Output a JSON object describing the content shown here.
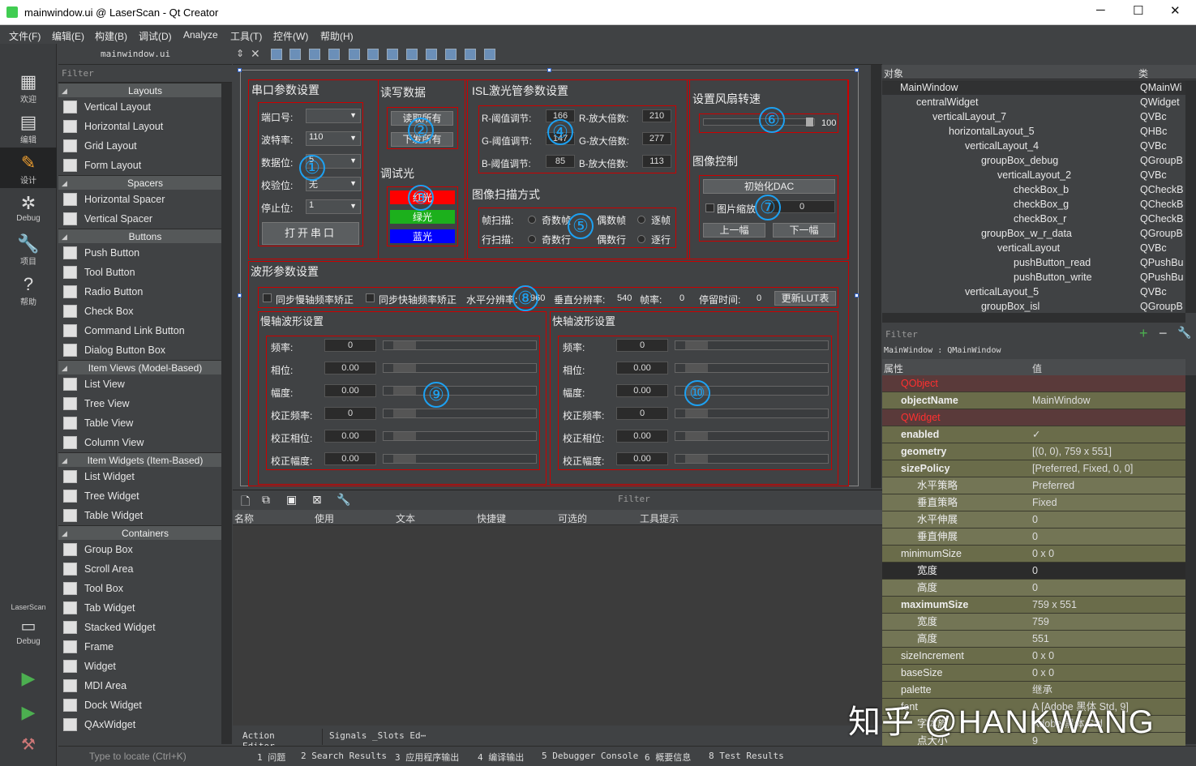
{
  "window": {
    "title": "mainwindow.ui @ LaserScan - Qt Creator",
    "min": "─",
    "max": "☐",
    "close": "✕"
  },
  "menu": [
    "文件(F)",
    "编辑(E)",
    "构建(B)",
    "调试(D)",
    "Analyze",
    "工具(T)",
    "控件(W)",
    "帮助(H)"
  ],
  "modes": [
    {
      "label": "欢迎",
      "icon": "▦"
    },
    {
      "label": "编辑",
      "icon": "▤"
    },
    {
      "label": "设计",
      "icon": "✎"
    },
    {
      "label": "Debug",
      "icon": "✲"
    },
    {
      "label": "项目",
      "icon": "🔧"
    },
    {
      "label": "帮助",
      "icon": "?"
    }
  ],
  "kit": {
    "name": "LaserScan",
    "debug": "Debug"
  },
  "editor": {
    "file": "mainwindow.ui"
  },
  "widgetbox": {
    "filter": "Filter",
    "categories": [
      {
        "name": "Layouts",
        "items": [
          "Vertical Layout",
          "Horizontal Layout",
          "Grid Layout",
          "Form Layout"
        ]
      },
      {
        "name": "Spacers",
        "items": [
          "Horizontal Spacer",
          "Vertical Spacer"
        ]
      },
      {
        "name": "Buttons",
        "items": [
          "Push Button",
          "Tool Button",
          "Radio Button",
          "Check Box",
          "Command Link Button",
          "Dialog Button Box"
        ]
      },
      {
        "name": "Item Views (Model-Based)",
        "items": [
          "List View",
          "Tree View",
          "Table View",
          "Column View"
        ]
      },
      {
        "name": "Item Widgets (Item-Based)",
        "items": [
          "List Widget",
          "Tree Widget",
          "Table Widget"
        ]
      },
      {
        "name": "Containers",
        "items": [
          "Group Box",
          "Scroll Area",
          "Tool Box",
          "Tab Widget",
          "Stacked Widget",
          "Frame",
          "Widget",
          "MDI Area",
          "Dock Widget",
          "QAxWidget"
        ]
      }
    ]
  },
  "form": {
    "serial": {
      "title": "串口参数设置",
      "port": "端口号:",
      "baud": "波特率:",
      "baud_val": "110",
      "data": "数据位:",
      "data_val": "5",
      "parity": "校验位:",
      "parity_val": "无",
      "stop": "停止位:",
      "stop_val": "1",
      "open": "打开串口"
    },
    "rw": {
      "title": "读写数据",
      "read": "读取所有",
      "write": "下发所有"
    },
    "light": {
      "title": "调试光",
      "red": "红光",
      "green": "绿光",
      "blue": "蓝光"
    },
    "isl": {
      "title": "ISL激光管参数设置",
      "r_th": "R-阈值调节:",
      "r_th_v": "166",
      "r_amp": "R-放大倍数:",
      "r_amp_v": "210",
      "g_th": "G-阈值调节:",
      "g_th_v": "147",
      "g_amp": "G-放大倍数:",
      "g_amp_v": "277",
      "b_th": "B-阈值调节:",
      "b_th_v": "85",
      "b_amp": "B-放大倍数:",
      "b_amp_v": "113"
    },
    "scan": {
      "title": "图像扫描方式",
      "frame": "帧扫描:",
      "odd_f": "奇数帧",
      "even_f": "偶数帧",
      "per_f": "逐帧",
      "line": "行扫描:",
      "odd_l": "奇数行",
      "even_l": "偶数行",
      "per_l": "逐行"
    },
    "fan": {
      "title": "设置风扇转速",
      "val": "100"
    },
    "img": {
      "title": "图像控制",
      "init": "初始化DAC",
      "zoom": "图片缩放",
      "zoom_v": "0",
      "prev": "上一幅",
      "next": "下一幅"
    },
    "wave": {
      "title": "波形参数设置",
      "sync_slow": "同步慢轴频率矫正",
      "sync_fast": "同步快轴频率矫正",
      "hres": "水平分辨率:",
      "hres_v": "960",
      "vres": "垂直分辨率:",
      "vres_v": "540",
      "fps": "帧率:",
      "fps_v": "0",
      "stay": "停留时间:",
      "stay_v": "0",
      "update": "更新LUT表"
    },
    "slow": {
      "title": "慢轴波形设置",
      "rows": [
        {
          "k": "频率:",
          "v": "0"
        },
        {
          "k": "相位:",
          "v": "0.00"
        },
        {
          "k": "幅度:",
          "v": "0.00"
        },
        {
          "k": "校正频率:",
          "v": "0"
        },
        {
          "k": "校正相位:",
          "v": "0.00"
        },
        {
          "k": "校正幅度:",
          "v": "0.00"
        }
      ]
    },
    "fast": {
      "title": "快轴波形设置",
      "rows": [
        {
          "k": "频率:",
          "v": "0"
        },
        {
          "k": "相位:",
          "v": "0.00"
        },
        {
          "k": "幅度:",
          "v": "0.00"
        },
        {
          "k": "校正频率:",
          "v": "0"
        },
        {
          "k": "校正相位:",
          "v": "0.00"
        },
        {
          "k": "校正幅度:",
          "v": "0.00"
        }
      ]
    },
    "marks": [
      "①",
      "②",
      "③",
      "④",
      "⑤",
      "⑥",
      "⑦",
      "⑧",
      "⑨",
      "⑩"
    ]
  },
  "action": {
    "filter": "Filter",
    "cols": [
      "名称",
      "使用",
      "文本",
      "快捷键",
      "可选的",
      "工具提示"
    ],
    "tabs": [
      "Action Editor",
      "Signals _Slots Ed⋯"
    ]
  },
  "objects": {
    "col1": "对象",
    "col2": "类",
    "rows": [
      {
        "n": "MainWindow",
        "c": "QMainWi",
        "d": 0
      },
      {
        "n": "centralWidget",
        "c": "QWidget",
        "d": 1
      },
      {
        "n": "verticalLayout_7",
        "c": "QVBc",
        "d": 2
      },
      {
        "n": "horizontalLayout_5",
        "c": "QHBc",
        "d": 3
      },
      {
        "n": "verticalLayout_4",
        "c": "QVBc",
        "d": 4
      },
      {
        "n": "groupBox_debug",
        "c": "QGroupB",
        "d": 5
      },
      {
        "n": "verticalLayout_2",
        "c": "QVBc",
        "d": 6
      },
      {
        "n": "checkBox_b",
        "c": "QCheckB",
        "d": 7
      },
      {
        "n": "checkBox_g",
        "c": "QCheckB",
        "d": 7
      },
      {
        "n": "checkBox_r",
        "c": "QCheckB",
        "d": 7
      },
      {
        "n": "groupBox_w_r_data",
        "c": "QGroupB",
        "d": 5
      },
      {
        "n": "verticalLayout",
        "c": "QVBc",
        "d": 6
      },
      {
        "n": "pushButton_read",
        "c": "QPushBu",
        "d": 7
      },
      {
        "n": "pushButton_write",
        "c": "QPushBu",
        "d": 7
      },
      {
        "n": "verticalLayout_5",
        "c": "QVBc",
        "d": 4
      },
      {
        "n": "groupBox_isl",
        "c": "QGroupB",
        "d": 5
      }
    ]
  },
  "props": {
    "filter": "Filter",
    "context": "MainWindow : QMainWindow",
    "col1": "属性",
    "col2": "值",
    "rows": [
      {
        "k": "QObject",
        "v": "",
        "t": "sec"
      },
      {
        "k": "objectName",
        "v": "MainWindow",
        "t": "bold"
      },
      {
        "k": "QWidget",
        "v": "",
        "t": "sec"
      },
      {
        "k": "enabled",
        "v": "✓",
        "t": "bold"
      },
      {
        "k": "geometry",
        "v": "[(0, 0), 759 x 551]",
        "t": "bold"
      },
      {
        "k": "sizePolicy",
        "v": "[Preferred, Fixed, 0, 0]",
        "t": "bold"
      },
      {
        "k": "水平策略",
        "v": "Preferred",
        "t": "sub"
      },
      {
        "k": "垂直策略",
        "v": "Fixed",
        "t": "sub"
      },
      {
        "k": "水平伸展",
        "v": "0",
        "t": "sub"
      },
      {
        "k": "垂直伸展",
        "v": "0",
        "t": "sub"
      },
      {
        "k": "minimumSize",
        "v": "0 x 0",
        "t": "n"
      },
      {
        "k": "宽度",
        "v": "0",
        "t": "subsel"
      },
      {
        "k": "高度",
        "v": "0",
        "t": "sub"
      },
      {
        "k": "maximumSize",
        "v": "759 x 551",
        "t": "bold"
      },
      {
        "k": "宽度",
        "v": "759",
        "t": "sub"
      },
      {
        "k": "高度",
        "v": "551",
        "t": "sub"
      },
      {
        "k": "sizeIncrement",
        "v": "0 x 0",
        "t": "n"
      },
      {
        "k": "baseSize",
        "v": "0 x 0",
        "t": "n"
      },
      {
        "k": "palette",
        "v": "继承",
        "t": "n"
      },
      {
        "k": "font",
        "v": "A [Adobe 黑体 Std, 9]",
        "t": "n"
      },
      {
        "k": "字体族",
        "v": "Adobe 黑体 Std",
        "t": "sub"
      },
      {
        "k": "点大小",
        "v": "9",
        "t": "sub"
      }
    ]
  },
  "status": {
    "locate": "Type to locate (Ctrl+K)",
    "tabs": [
      "1 问题",
      "2 Search Results",
      "3 应用程序输出",
      "4 编译输出",
      "5 Debugger Console",
      "6 概要信息",
      "8 Test Results"
    ]
  },
  "watermark": "知乎 @HANKWANG",
  "colors": {
    "red": "#ff0000",
    "green": "#1cb01c",
    "blue": "#0000ff",
    "accent": "#1da1f2",
    "section": "#ff3030"
  }
}
